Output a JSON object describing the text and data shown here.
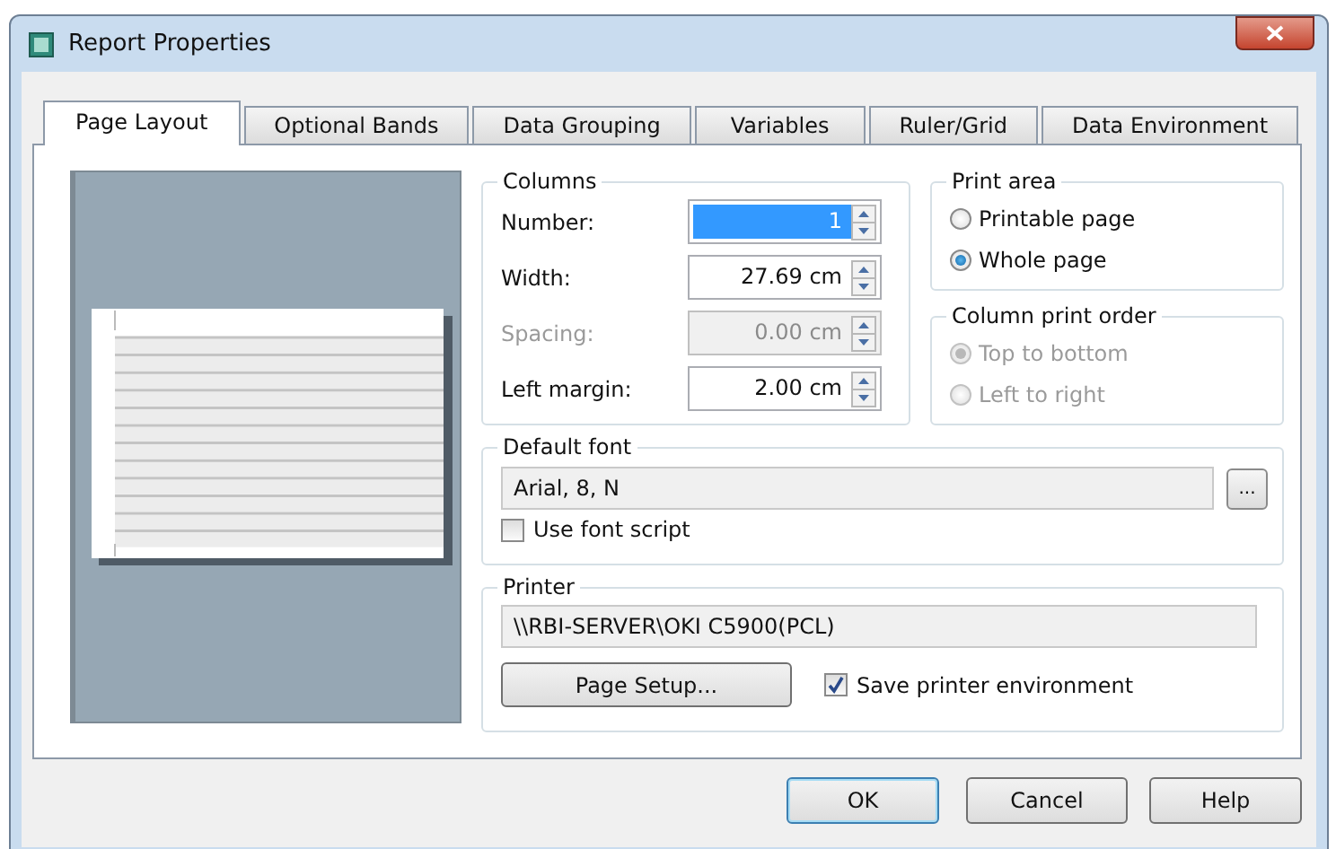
{
  "window": {
    "title": "Report Properties"
  },
  "tabs": [
    {
      "label": "Page Layout",
      "selected": true
    },
    {
      "label": "Optional Bands",
      "selected": false
    },
    {
      "label": "Data Grouping",
      "selected": false
    },
    {
      "label": "Variables",
      "selected": false
    },
    {
      "label": "Ruler/Grid",
      "selected": false
    },
    {
      "label": "Data Environment",
      "selected": false
    }
  ],
  "columns": {
    "title": "Columns",
    "fields": [
      {
        "label": "Number:",
        "value": "1",
        "selected": true,
        "disabled": false
      },
      {
        "label": "Width:",
        "value": "27.69 cm",
        "selected": false,
        "disabled": false
      },
      {
        "label": "Spacing:",
        "value": "0.00 cm",
        "selected": false,
        "disabled": true
      },
      {
        "label": "Left margin:",
        "value": "2.00 cm",
        "selected": false,
        "disabled": false
      }
    ]
  },
  "print_area": {
    "title": "Print area",
    "options": [
      {
        "label": "Printable page",
        "selected": false,
        "disabled": false
      },
      {
        "label": "Whole page",
        "selected": true,
        "disabled": false
      }
    ]
  },
  "column_print_order": {
    "title": "Column print order",
    "options": [
      {
        "label": "Top to bottom",
        "selected": true,
        "disabled": true
      },
      {
        "label": "Left to right",
        "selected": false,
        "disabled": true
      }
    ]
  },
  "default_font": {
    "title": "Default font",
    "value": "Arial, 8, N",
    "browse_button": "...",
    "use_font_script": {
      "label": "Use font script",
      "checked": false
    }
  },
  "printer": {
    "title": "Printer",
    "value": "\\\\RBI-SERVER\\OKI C5900(PCL)",
    "page_setup_button": "Page Setup...",
    "save_environment": {
      "label": "Save printer environment",
      "checked": true
    }
  },
  "buttons": [
    {
      "label": "OK",
      "default": true
    },
    {
      "label": "Cancel",
      "default": false
    },
    {
      "label": "Help",
      "default": false
    }
  ]
}
